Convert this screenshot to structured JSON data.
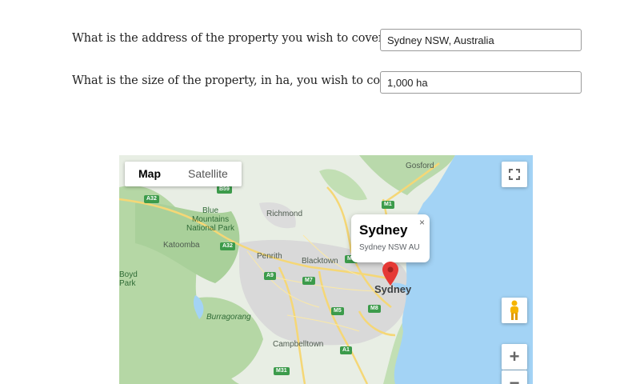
{
  "form": {
    "address_question": "What is the address of the property you wish to cover?",
    "address_value": "Sydney NSW, Australia",
    "size_question": "What is the size of the property, in ha, you wish to cover?",
    "size_value": "1,000 ha"
  },
  "map": {
    "type_control": {
      "map": "Map",
      "satellite": "Satellite",
      "selected": "Map"
    },
    "info_window": {
      "title": "Sydney",
      "subtitle": "Sydney NSW AU",
      "close": "×"
    },
    "zoom_in": "+",
    "zoom_out": "−",
    "places": {
      "gosford": "Gosford",
      "richmond": "Richmond",
      "blue_mountains": "Blue\nMountains\nNational Park",
      "katoomba": "Katoomba",
      "penrith": "Penrith",
      "blacktown": "Blacktown",
      "sydney": "Sydney",
      "boyd_park": "Boyd\nPark",
      "burragorang": "Burragorang",
      "campbelltown": "Campbelltown"
    },
    "shields": {
      "a32_top": "A32",
      "b59": "B59",
      "a32_mid": "A32",
      "m1": "M1",
      "a9": "A9",
      "m7": "M7",
      "m5": "M5",
      "m8": "M8",
      "a1": "A1",
      "m31": "M31",
      "m2": "M2"
    },
    "colors": {
      "water": "#a3d3f5",
      "land": "#e8eee4",
      "forest": "#b5d7a5",
      "urban": "#d6d6d6",
      "road": "#f5d776",
      "pin": "#e53935"
    }
  }
}
